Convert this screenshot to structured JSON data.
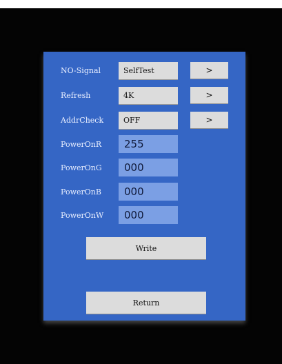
{
  "settings": {
    "no_signal": {
      "label": "NO-Signal",
      "value": "SelfTest",
      "action": ">"
    },
    "refresh": {
      "label": "Refresh",
      "value": "4K",
      "action": ">"
    },
    "addr_check": {
      "label": "AddrCheck",
      "value": "OFF",
      "action": ">"
    },
    "power_on_r": {
      "label": "PowerOnR",
      "value": "255"
    },
    "power_on_g": {
      "label": "PowerOnG",
      "value": "000"
    },
    "power_on_b": {
      "label": "PowerOnB",
      "value": "000"
    },
    "power_on_w": {
      "label": "PowerOnW",
      "value": "000"
    }
  },
  "buttons": {
    "write": "Write",
    "return": "Return"
  },
  "colors": {
    "panel": "#3566c5",
    "input_field": "#7b9fe4",
    "button": "#dcdcdc",
    "frame": "#040404"
  }
}
